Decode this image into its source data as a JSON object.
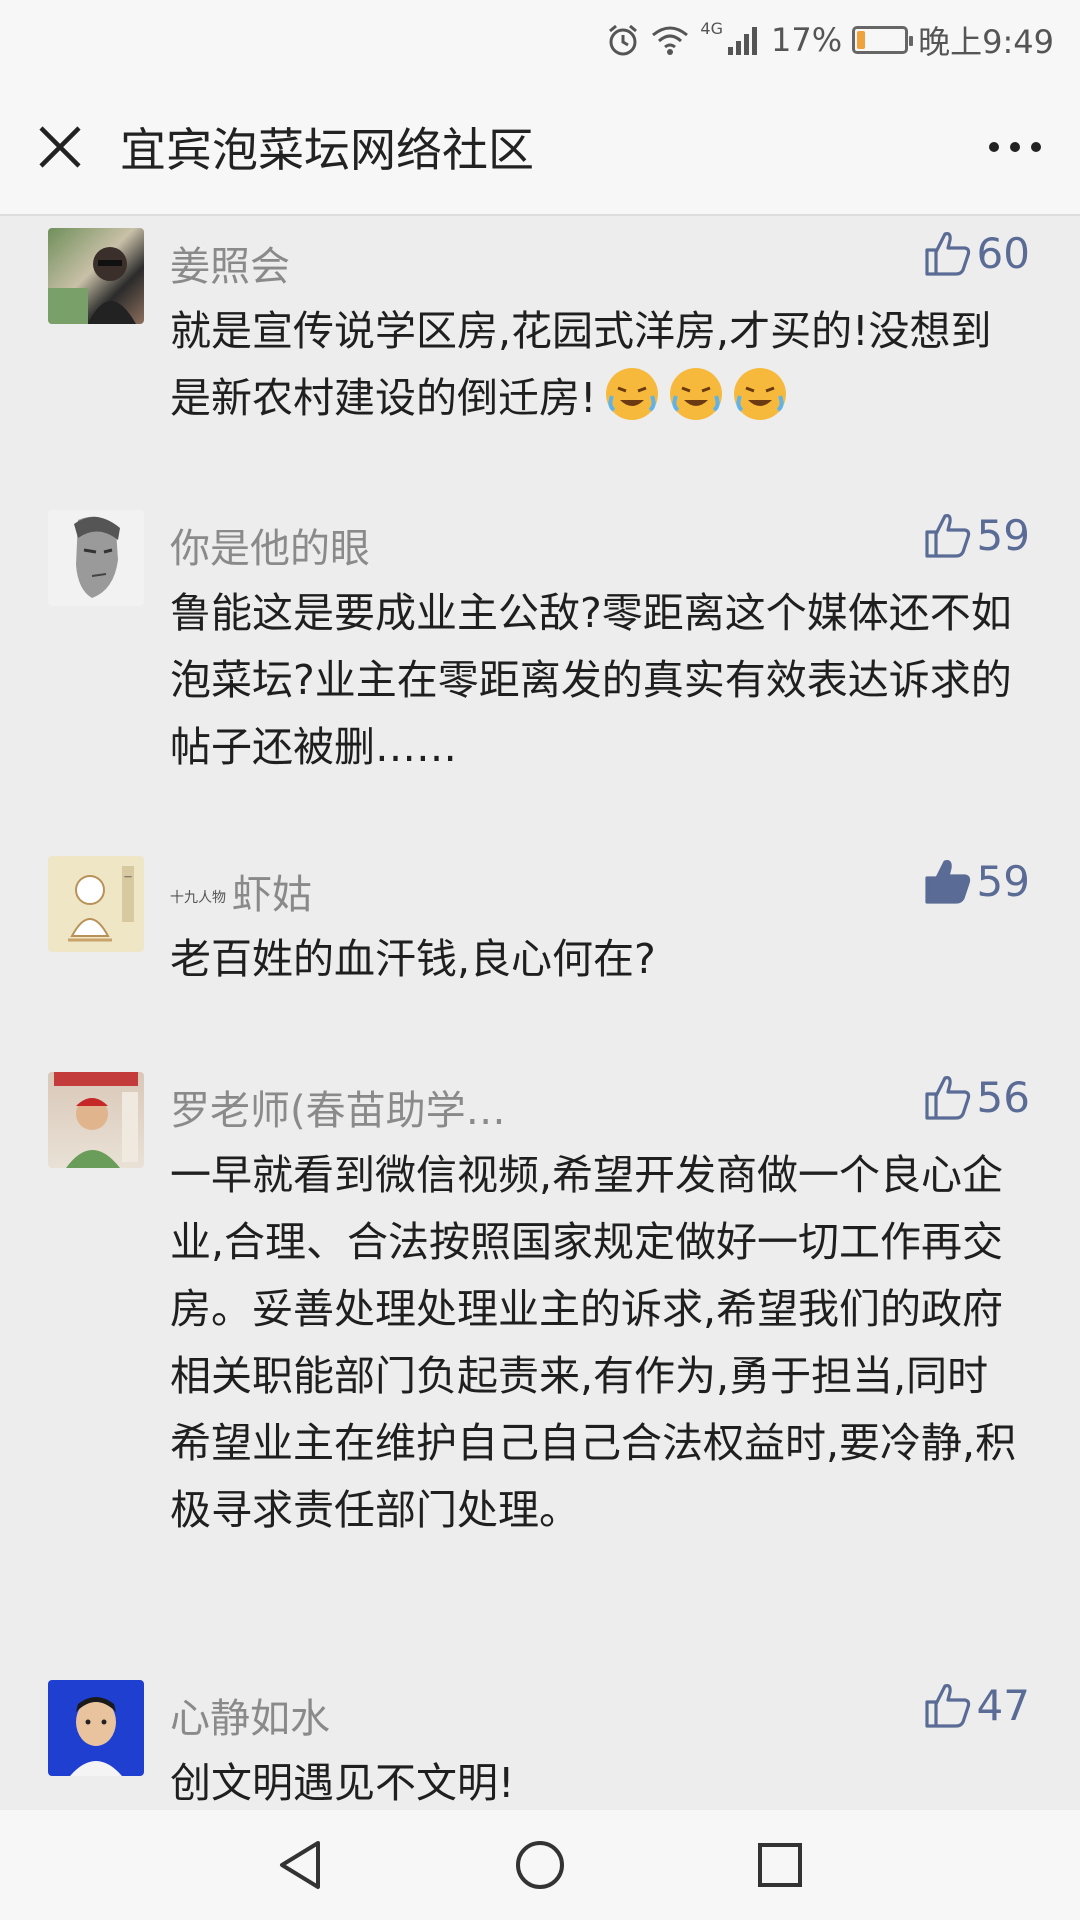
{
  "status_bar": {
    "network": "4G",
    "battery": "17%",
    "battery_level": 0.17,
    "time": "晚上9:49"
  },
  "header": {
    "title": "宜宾泡菜坛网络社区"
  },
  "comments": [
    {
      "author": "姜照会",
      "likes": "60",
      "text": "就是宣传说学区房,花园式洋房,才买的!没想到是新农村建设的倒迁房!",
      "emojis": [
        "crying-laughing-emoji",
        "crying-laughing-emoji",
        "crying-laughing-emoji"
      ],
      "liked": false
    },
    {
      "author": "你是他的眼",
      "likes": "59",
      "text": "鲁能这是要成业主公敌?零距离这个媒体还不如泡菜坛?业主在零距离发的真实有效表达诉求的帖子还被删……",
      "liked": false
    },
    {
      "author_prefix": "十九人物",
      "author": "虾姑",
      "likes": "59",
      "text": "老百姓的血汗钱,良心何在?",
      "liked": true
    },
    {
      "author": "罗老师(春苗助学…",
      "likes": "56",
      "text": "一早就看到微信视频,希望开发商做一个良心企业,合理、合法按照国家规定做好一切工作再交房。妥善处理处理业主的诉求,希望我们的政府相关职能部门负起责来,有作为,勇于担当,同时希望业主在维护自己自己合法权益时,要冷静,积极寻求责任部门处理。",
      "liked": false
    },
    {
      "author": "心静如水",
      "likes": "47",
      "text": "创文明遇见不文明!",
      "liked": false
    }
  ],
  "colors": {
    "accent": "#5a6b95",
    "background": "#ededed",
    "header_bg": "#f7f7f7"
  },
  "nav_bar": {
    "icons": [
      "back-triangle-icon",
      "home-circle-icon",
      "recents-square-icon"
    ]
  }
}
